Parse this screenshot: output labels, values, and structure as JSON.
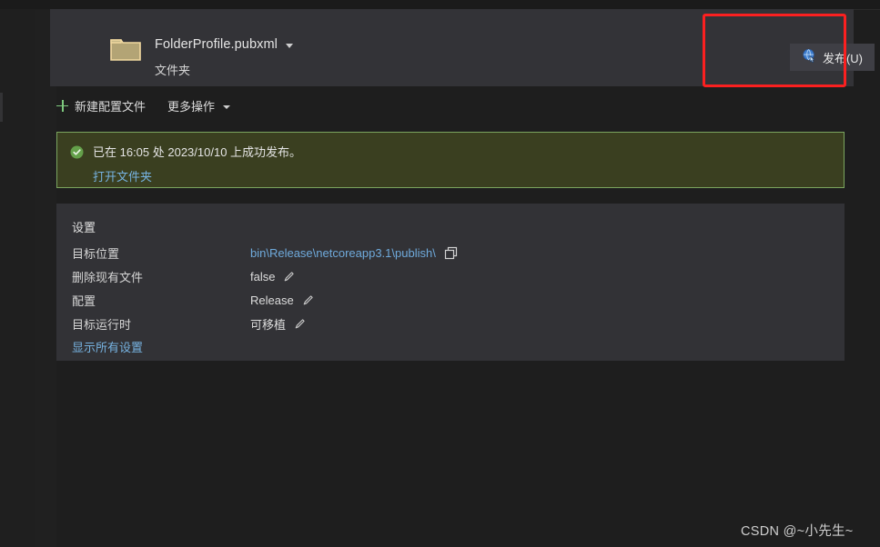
{
  "theme": {
    "window_bg": "#1e1e1e",
    "card_bg": "#333337",
    "panel_bg": "#323236",
    "link_color": "#76b2e0",
    "banner_bg": "#3a3f20",
    "banner_border": "#7ba55f",
    "annotation_color": "#fb2020",
    "accent_green": "#7ec97e",
    "folder_color": "#f2d9a0"
  },
  "header": {
    "folder_icon": "folder-icon",
    "profile_name": "FolderProfile.pubxml",
    "profile_dropdown_icon": "chevron-down-icon",
    "profile_type": "文件夹",
    "publish_button": {
      "label": "发布(U)",
      "icon": "publish-globe-icon"
    },
    "annotation": {
      "shape": "rectangle",
      "color": "#fb2020"
    }
  },
  "command_bar": {
    "items": [
      {
        "label": "新建配置文件",
        "icon": "plus-icon",
        "has_caret": false
      },
      {
        "label": "更多操作",
        "icon": "",
        "has_caret": true
      }
    ]
  },
  "status_banner": {
    "icon": "success-check-icon",
    "message": "已在 16:05 处 2023/10/10 上成功发布。",
    "time": "16:05",
    "date": "2023/10/10",
    "link": "打开文件夹"
  },
  "settings": {
    "title": "设置",
    "rows": [
      {
        "label": "目标位置",
        "value": "bin\\Release\\netcoreapp3.1\\publish\\",
        "is_link": true,
        "action_icon": "copy-icon"
      },
      {
        "label": "删除现有文件",
        "value": "false",
        "is_link": false,
        "action_icon": "pencil-icon"
      },
      {
        "label": "配置",
        "value": "Release",
        "is_link": false,
        "action_icon": "pencil-icon"
      },
      {
        "label": "目标运行时",
        "value": "可移植",
        "is_link": false,
        "action_icon": "pencil-icon"
      }
    ],
    "show_all_link": "显示所有设置"
  },
  "watermark": {
    "text": "CSDN @~小先生~"
  }
}
